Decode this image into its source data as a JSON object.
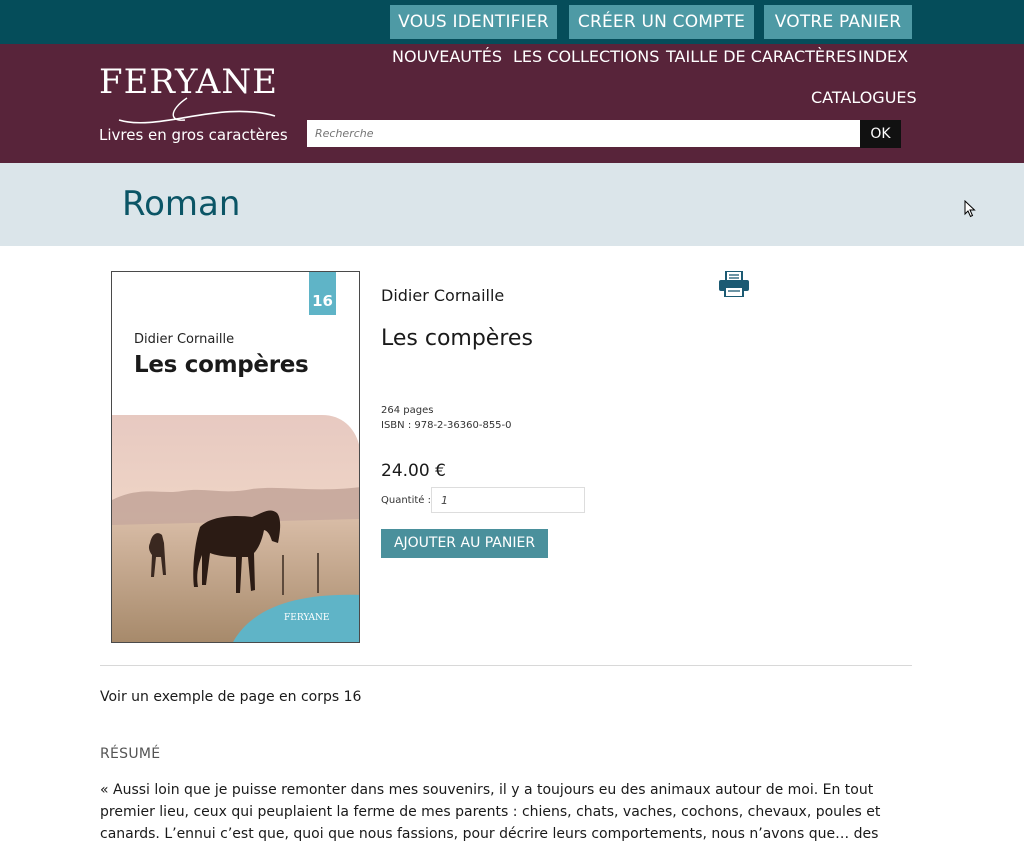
{
  "topbar": {
    "login": "VOUS IDENTIFIER",
    "signup": "CRÉER UN COMPTE",
    "cart": "VOTRE PANIER"
  },
  "brand": {
    "name": "FERYANE",
    "tagline": "Livres en gros caractères"
  },
  "nav": {
    "items": [
      "NOUVEAUTÉS",
      "LES COLLECTIONS",
      "TAILLE DE CARACTÈRES",
      "INDEX",
      "CATALOGUES"
    ]
  },
  "search": {
    "placeholder": "Recherche",
    "button": "OK"
  },
  "category": {
    "title": "Roman"
  },
  "cover": {
    "badge": "16",
    "author": "Didier Cornaille",
    "title": "Les compères",
    "publisher": "FERYANE"
  },
  "product": {
    "author": "Didier Cornaille",
    "title": "Les compères",
    "pages": "264 pages",
    "isbn": "ISBN : 978-2-36360-855-0",
    "price": "24.00 €",
    "quantity_label": "Quantité :",
    "quantity_value": "1",
    "add_to_cart": "AJOUTER AU PANIER"
  },
  "sample_link": "Voir un exemple de page en corps 16",
  "summary": {
    "heading": "RÉSUMÉ",
    "text": "« Aussi loin que je puisse remonter dans mes souvenirs, il y a toujours eu des animaux autour de moi. En tout premier lieu, ceux qui peuplaient la ferme de mes parents : chiens, chats, vaches, cochons, chevaux, poules et canards. L’ennui c’est que, quoi que nous fassions, pour décrire leurs comportements, nous n’avons que… des mots ! Ce qu’ils n’ont pas."
  },
  "colors": {
    "topbar": "#054d5a",
    "topbar_button": "#4e9aa5",
    "header": "#58243a",
    "banner": "#dbe5ea",
    "banner_text": "#0b5566",
    "cover_accent": "#5fb4c7",
    "add_button": "#4a909c"
  },
  "icons": {
    "print": "printer-icon",
    "cursor": "mouse-pointer-icon"
  }
}
